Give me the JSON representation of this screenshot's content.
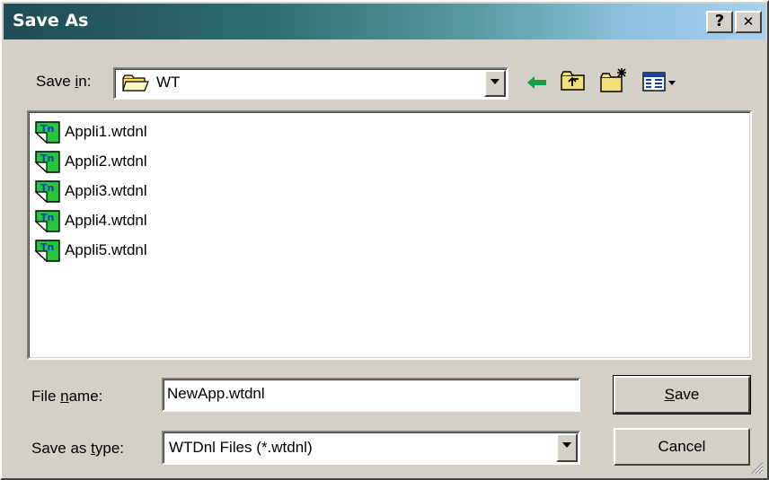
{
  "window": {
    "title": "Save As",
    "help_glyph": "?",
    "close_glyph": "✕"
  },
  "save_in": {
    "label_pre": "Save ",
    "label_accel": "i",
    "label_post": "n:",
    "value": "WT",
    "folder_icon": "folder-icon"
  },
  "toolbar": {
    "back_icon": "back-arrow-icon",
    "up_icon": "up-one-level-icon",
    "new_folder_icon": "new-folder-icon",
    "view_menu_icon": "view-menu-icon"
  },
  "files": [
    {
      "name": "Appli1.wtdnl",
      "icon": "wtdnl-file-icon"
    },
    {
      "name": "Appli2.wtdnl",
      "icon": "wtdnl-file-icon"
    },
    {
      "name": "Appli3.wtdnl",
      "icon": "wtdnl-file-icon"
    },
    {
      "name": "Appli4.wtdnl",
      "icon": "wtdnl-file-icon"
    },
    {
      "name": "Appli5.wtdnl",
      "icon": "wtdnl-file-icon"
    }
  ],
  "file_name": {
    "label_pre": "File ",
    "label_accel": "n",
    "label_post": "ame:",
    "value": "NewApp.wtdnl"
  },
  "save_type": {
    "label_pre": "Save as ",
    "label_accel": "t",
    "label_post": "ype:",
    "value": "WTDnl Files (*.wtdnl)"
  },
  "buttons": {
    "save_accel": "S",
    "save_rest": "ave",
    "cancel": "Cancel"
  },
  "colors": {
    "face": "#d4d0c8",
    "title_start": "#1f4c55",
    "title_end": "#a6d0f0",
    "file_icon_green": "#22c83a",
    "back_arrow_green": "#10a040"
  }
}
